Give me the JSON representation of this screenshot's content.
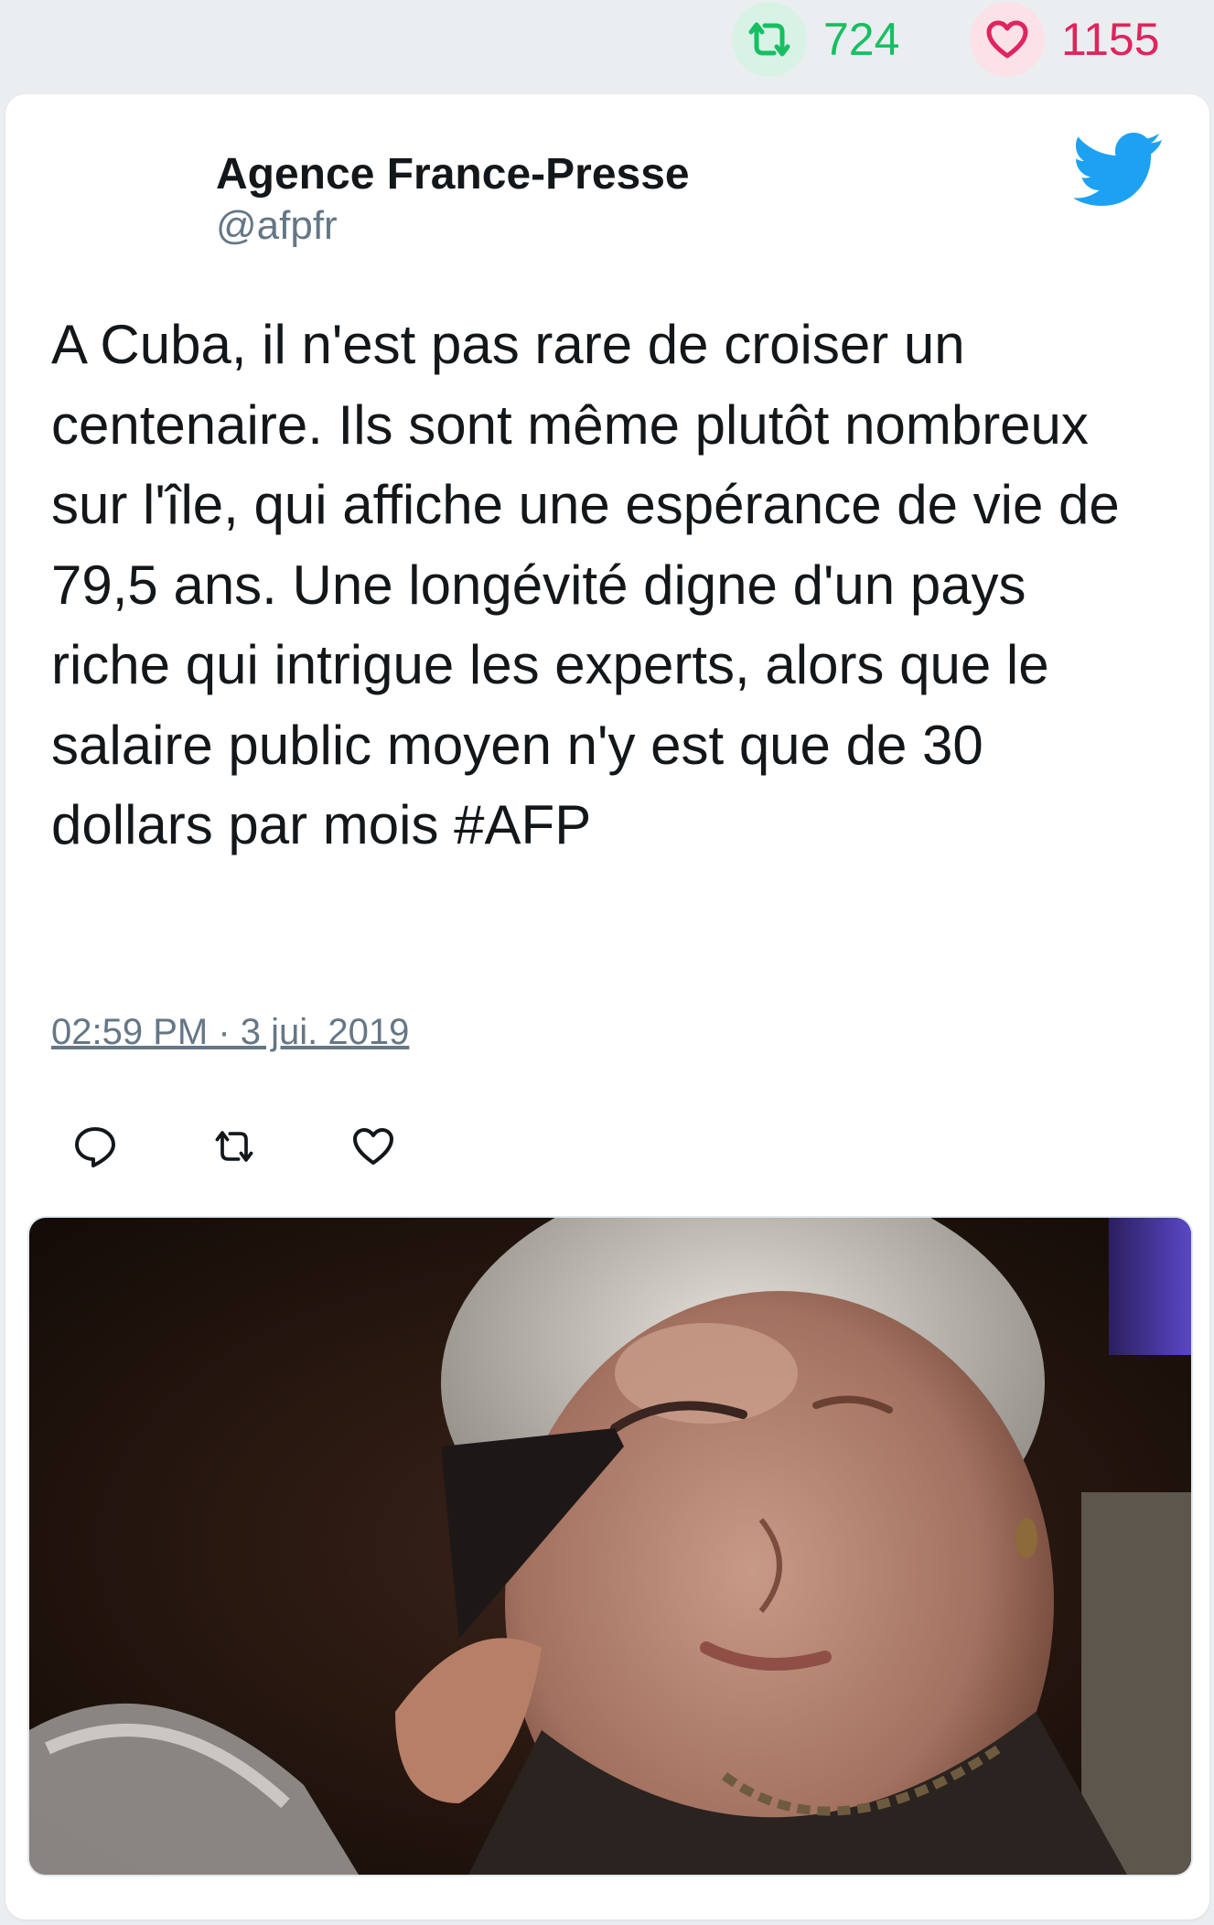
{
  "stats": {
    "retweets": "724",
    "likes": "1155"
  },
  "tweet": {
    "author_name": "Agence France-Presse",
    "author_handle": "@afpfr",
    "text": "A Cuba, il n'est pas rare de croiser un centenaire. Ils sont même plutôt nombreux sur l'île, qui affiche une espérance de vie de 79,5 ans. Une longévité digne d'un pays riche qui intrigue les experts, alors que le salaire public moyen n'y est que de 30 dollars par mois #AFP",
    "timestamp": "02:59 PM · 3 jui. 2019"
  },
  "icons": {
    "retweet": "retweet-icon",
    "like": "heart-icon",
    "reply": "reply-icon",
    "brand": "twitter-bird-icon"
  },
  "colors": {
    "retweet": "#17bf63",
    "like": "#e0245e",
    "brand": "#1da1f2",
    "text": "#14171a",
    "muted": "#657786"
  },
  "media": {
    "type": "photo"
  }
}
